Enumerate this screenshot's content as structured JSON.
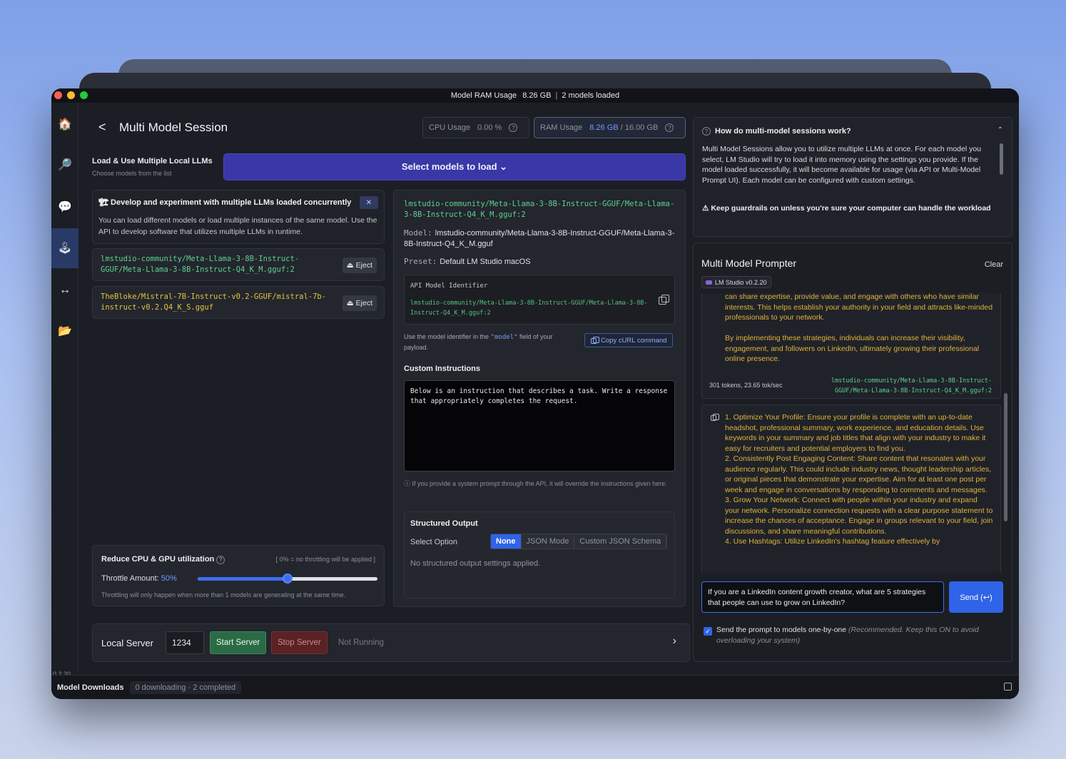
{
  "titlebar": {
    "label": "Model RAM Usage",
    "value": "8.26 GB",
    "separator": "|",
    "models": "2 models loaded"
  },
  "sidebar": {
    "items": [
      {
        "icon": "home-icon",
        "glyph": "🏠"
      },
      {
        "icon": "search-icon",
        "glyph": "🔎"
      },
      {
        "icon": "chat-icon",
        "glyph": "💬"
      },
      {
        "icon": "multi-model-icon",
        "glyph": "🕹"
      },
      {
        "icon": "server-arrows-icon",
        "glyph": "↔"
      },
      {
        "icon": "folder-icon",
        "glyph": "📂"
      }
    ],
    "version": "0.2.20"
  },
  "header": {
    "back": "<",
    "title": "Multi Model Session"
  },
  "stats": {
    "cpu_label": "CPU Usage",
    "cpu_value": "0.00 %",
    "ram_label": "RAM Usage",
    "ram_value": "8.26 GB",
    "ram_total": " / 16.00 GB",
    "help": "?"
  },
  "load": {
    "title": "Load & Use Multiple Local LLMs",
    "subtitle": "Choose models from the list",
    "select_button": "Select models to load ⌄"
  },
  "info": {
    "title": "🏗 Develop and experiment with multiple LLMs loaded concurrently",
    "close": "✕",
    "body": "You can load different models or load multiple instances of the same model. Use the API to develop software that utilizes multiple LLMs in runtime."
  },
  "loaded_models": [
    {
      "name": "lmstudio-community/Meta-Llama-3-8B-Instruct-GGUF/Meta-Llama-3-8B-Instruct-Q4_K_M.gguf:2",
      "color": "#5fd08f",
      "eject": "Eject",
      "eject_icon": "⏏"
    },
    {
      "name": "TheBloke/Mistral-7B-Instruct-v0.2-GGUF/mistral-7b-instruct-v0.2.Q4_K_S.gguf",
      "color": "#e2c33d",
      "eject": "Eject",
      "eject_icon": "⏏"
    }
  ],
  "throttle": {
    "title": "Reduce CPU & GPU utilization",
    "note": "[ 0% = no throttling will be applied ]",
    "label": "Throttle Amount: ",
    "pct": "50%",
    "value": 0.5,
    "sub": "Throttling will only happen when more than 1 models are generating at the same time."
  },
  "server": {
    "title": "Local Server",
    "port": "1234",
    "start": "Start Server",
    "stop": "Stop Server",
    "status": "Not Running",
    "chevron": "›"
  },
  "config": {
    "model_path": "lmstudio-community/Meta-Llama-3-8B-Instruct-GGUF/Meta-Llama-3-8B-Instruct-Q4_K_M.gguf:2",
    "model_key": "Model:",
    "model_value": "lmstudio-community/Meta-Llama-3-8B-Instruct-GGUF/Meta-Llama-3-8B-Instruct-Q4_K_M.gguf",
    "preset_key": "Preset:",
    "preset_value": "Default LM Studio macOS",
    "api_label": "API Model Identifier",
    "api_id": "lmstudio-community/Meta-Llama-3-8B-Instruct-GGUF/Meta-Llama-3-8B-Instruct-Q4_K_M.gguf:2",
    "api_hint_pre": "Use the model identifier in the ",
    "api_hint_code": "\"model\"",
    "api_hint_post": " field of your payload.",
    "curl_button": "Copy cURL command",
    "ci_title": "Custom Instructions",
    "ci_text": "Below is an instruction that describes a task. Write a response that appropriately completes the request.",
    "ci_note": "ⓘ If you provide a system prompt through the API, it will override the instructions given here.",
    "so_title": "Structured Output",
    "so_label": "Select Option",
    "so_options": [
      "None",
      "JSON Mode",
      "Custom JSON Schema"
    ],
    "so_selected": "None",
    "so_msg": "No structured output settings applied."
  },
  "faq": {
    "icon": "?",
    "question": "How do multi-model sessions work?",
    "chevron": "⌃",
    "answer": "Multi Model Sessions allow you to utilize multiple LLMs at once. For each model you select, LM Studio will try to load it into memory using the settings you provide. If the model loaded successfully, it will become available for usage (via API or Multi-Model Prompt UI). Each model can be configured with custom settings.",
    "warning": "⚠ Keep guardrails on unless you're sure your computer can handle the workload"
  },
  "prompter": {
    "title": "Multi Model Prompter",
    "clear": "Clear",
    "badge": "LM Studio v0.2.20",
    "resp1_a": "can share expertise, provide value, and engage with others who have similar interests. This helps establish your authority in your field and attracts like-minded professionals to your network.",
    "resp1_b": "By implementing these strategies, individuals can increase their visibility, engagement, and followers on LinkedIn, ultimately growing their professional online presence.",
    "resp1_meta": "301 tokens, 23.65 tok/sec",
    "resp1_model": "lmstudio-community/Meta-Llama-3-8B-Instruct-GGUF/Meta-Llama-3-8B-Instruct-Q4_K_M.gguf:2",
    "resp2_items": [
      "1. Optimize Your Profile: Ensure your profile is complete with an up-to-date headshot, professional summary, work experience, and education details. Use keywords in your summary and job titles that align with your industry to make it easy for recruiters and potential employers to find you.",
      "2. Consistently Post Engaging Content: Share content that resonates with your audience regularly. This could include industry news, thought leadership articles, or original pieces that demonstrate your expertise. Aim for at least one post per week and engage in conversations by responding to comments and messages.",
      "3. Grow Your Network: Connect with people within your industry and expand your network. Personalize connection requests with a clear purpose statement to increase the chances of acceptance. Engage in groups relevant to your field, join discussions, and share meaningful contributions.",
      "4. Use Hashtags: Utilize LinkedIn's hashtag feature effectively by"
    ],
    "prompt": "If you are a LinkedIn content growth creator, what are 5 strategies that people can use to grow on LinkedIn?",
    "send": "Send (↩)",
    "check_label": "Send the prompt to models one-by-one",
    "check_hint": " (Recommended. Keep this ON to avoid overloading your system)",
    "checked": "✓"
  },
  "bottombar": {
    "title": "Model Downloads",
    "status": "0 downloading · 2 completed"
  }
}
